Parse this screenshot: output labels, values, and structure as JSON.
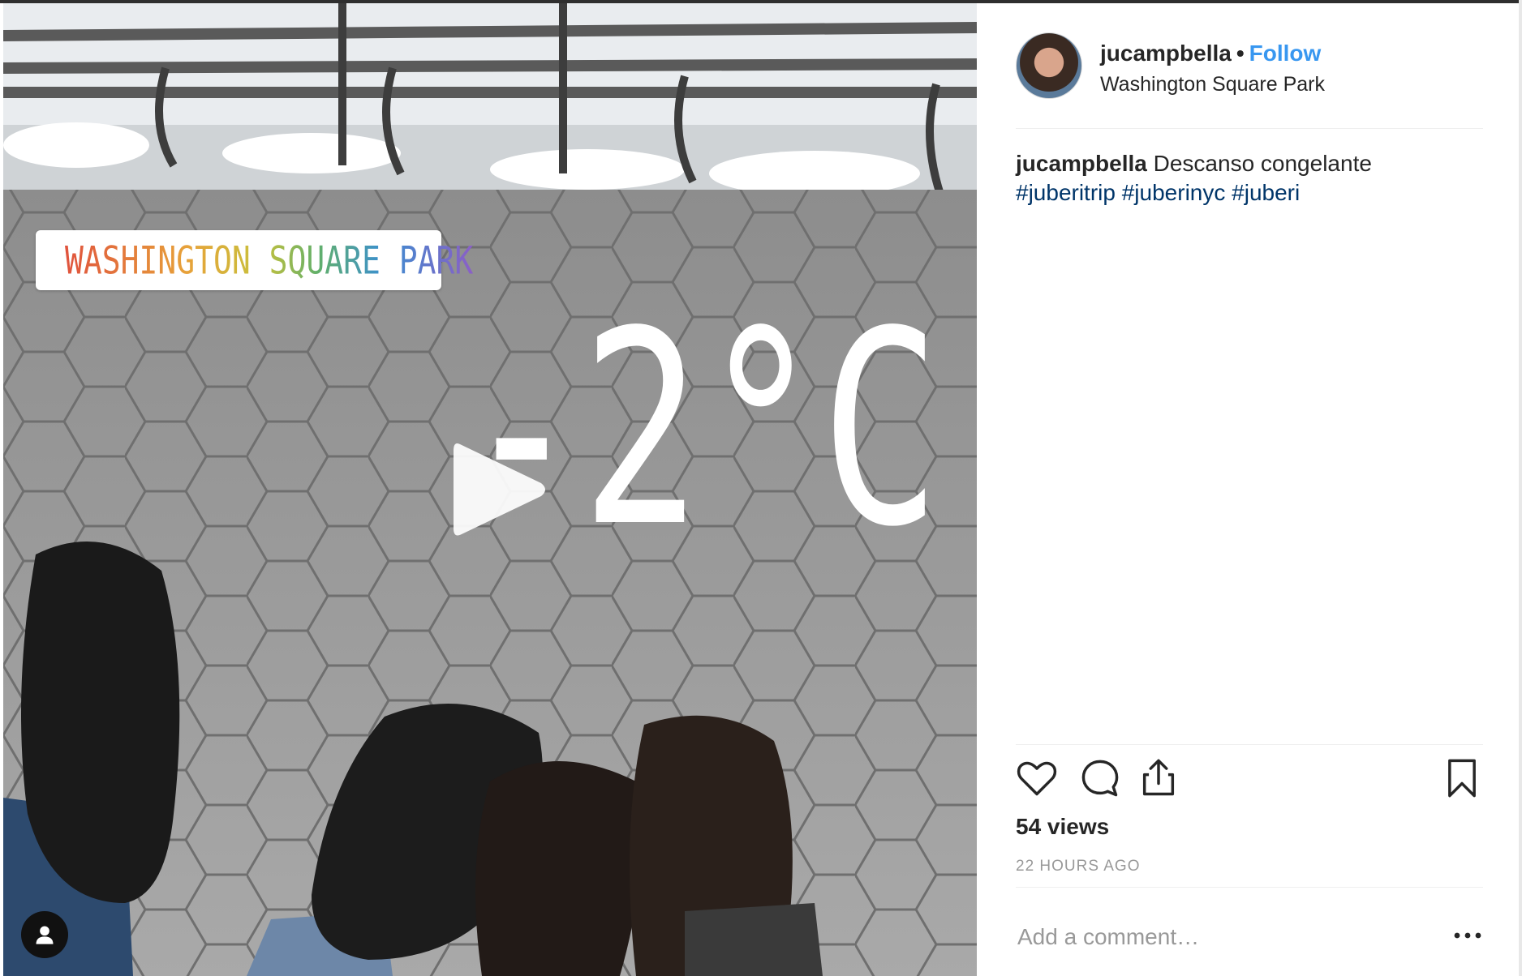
{
  "media": {
    "location_sticker": "WASHINGTON SQUARE PARK",
    "temperature_sticker": "-2°C",
    "icons": {
      "play": "play-icon",
      "pin": "location-pin-icon",
      "profile": "user-profile-icon"
    }
  },
  "header": {
    "username": "jucampbella",
    "separator": "•",
    "follow_label": "Follow",
    "location": "Washington Square Park"
  },
  "caption": {
    "username": "jucampbella",
    "text": "Descanso congelante",
    "hashtags": [
      "#juberitrip",
      "#juberinyc",
      "#juberi"
    ]
  },
  "actions": {
    "icons": [
      "heart-icon",
      "comment-icon",
      "share-icon",
      "bookmark-icon"
    ]
  },
  "views": "54 views",
  "timestamp": "22 HOURS AGO",
  "comment": {
    "placeholder": "Add a comment…",
    "more_icon": "more-options-icon"
  },
  "colors": {
    "follow": "#3897f0",
    "hashtag": "#003569",
    "muted": "#999999",
    "text": "#262626"
  }
}
